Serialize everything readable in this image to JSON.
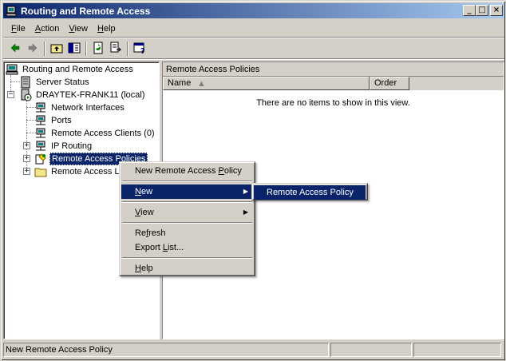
{
  "window": {
    "title": "Routing and Remote Access",
    "icon": "computer-icon",
    "buttons": {
      "minimize": "_",
      "maximize": "□",
      "close": "×"
    }
  },
  "menubar": {
    "items": [
      {
        "accel": "F",
        "rest": "ile"
      },
      {
        "accel": "A",
        "rest": "ction"
      },
      {
        "accel": "V",
        "rest": "iew"
      },
      {
        "accel": "H",
        "rest": "elp"
      }
    ]
  },
  "toolbar": {
    "icons": [
      "back-arrow-icon",
      "forward-arrow-icon",
      "up-folder-icon",
      "show-hide-tree-icon",
      "refresh-icon",
      "export-list-icon",
      "help-icon"
    ]
  },
  "tree": {
    "root": "Routing and Remote Access",
    "server_status": "Server Status",
    "server": "DRAYTEK-FRANK11 (local)",
    "children": [
      "Network Interfaces",
      "Ports",
      "Remote Access Clients (0)",
      "IP Routing",
      "Remote Access Policies",
      "Remote Access Lo"
    ]
  },
  "right_pane": {
    "header": "Remote Access Policies",
    "columns": [
      "Name",
      "Order"
    ],
    "empty_message": "There are no items to show in this view."
  },
  "context_menu": {
    "items": [
      {
        "text": "New Remote Access ",
        "accel": "P",
        "rest": "olicy"
      },
      {
        "text": "",
        "accel": "N",
        "rest": "ew",
        "submenu": true,
        "active": true
      },
      {
        "text": "",
        "accel": "V",
        "rest": "iew",
        "submenu": true
      },
      {
        "text": "Re",
        "accel": "f",
        "rest": "resh"
      },
      {
        "text": "Export ",
        "accel": "L",
        "rest": "ist..."
      },
      {
        "text": "",
        "accel": "H",
        "rest": "elp"
      }
    ]
  },
  "submenu": {
    "item": "Remote Access Policy"
  },
  "statusbar": {
    "text": "New Remote Access Policy"
  },
  "colors": {
    "selection": "#0a246a",
    "face": "#d4d0c8"
  }
}
